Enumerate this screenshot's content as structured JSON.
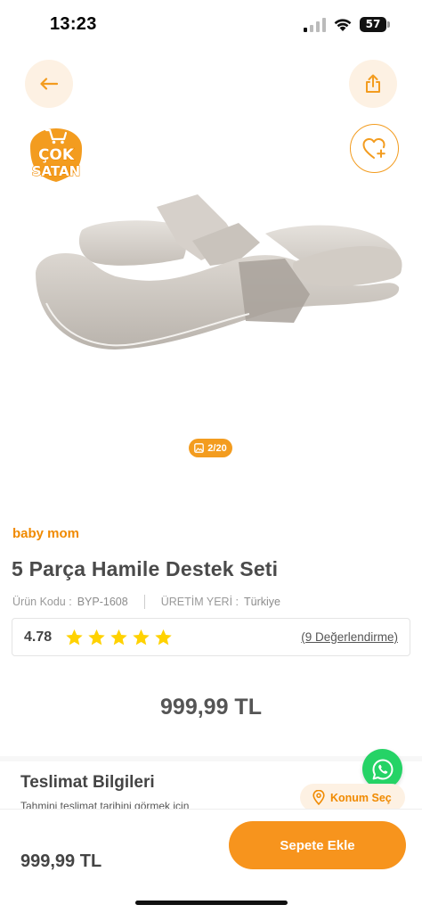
{
  "status": {
    "time": "13:23",
    "battery": "57"
  },
  "icons": {
    "back": "arrow-left-icon",
    "share": "share-icon",
    "favorite": "heart-plus-icon",
    "gallery": "image-icon",
    "star": "star-icon",
    "whatsapp": "whatsapp-icon",
    "location": "location-pin-icon"
  },
  "badge": {
    "line1": "ÇOK",
    "line2": "SATAN"
  },
  "gallery": {
    "counter": "2/20"
  },
  "product": {
    "brand": "baby mom",
    "title": "5 Parça Hamile Destek Seti",
    "code_label": "Ürün Kodu :",
    "code_value": "BYP-1608",
    "origin_label": "ÜRETİM YERİ :",
    "origin_value": "Türkiye",
    "rating": "4.78",
    "stars": 5,
    "reviews": "(9 Değerlendirme)",
    "price": "999,99 TL"
  },
  "delivery": {
    "title": "Teslimat Bilgileri",
    "subtitle": "Tahmini teslimat tarihini görmek için",
    "location_button": "Konum Seç"
  },
  "bottom": {
    "price": "999,99 TL",
    "cart_button": "Sepete Ekle"
  },
  "colors": {
    "accent": "#F39C1F",
    "accent_light": "#FDF1E3",
    "star": "#FFD200",
    "whatsapp": "#25D366"
  }
}
